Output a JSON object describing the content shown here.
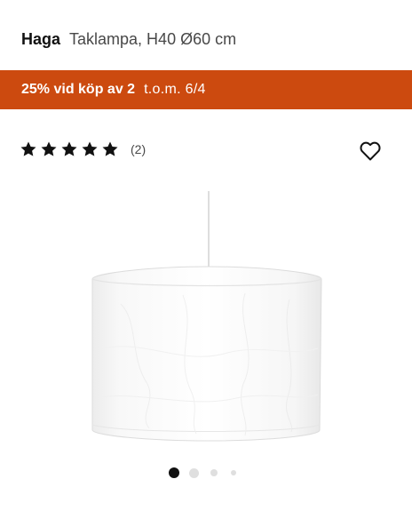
{
  "product": {
    "name": "Haga",
    "description": "Taklampa, H40 Ø60 cm"
  },
  "promo": {
    "text": "25% vid köp av 2",
    "date": "t.o.m. 6/4",
    "color": "#cc4a0f"
  },
  "rating": {
    "stars": 5,
    "max_stars": 5,
    "review_count": "(2)"
  },
  "favorite": {
    "icon": "heart-outline-icon"
  },
  "image": {
    "subject": "white pendant lamp shade"
  },
  "carousel": {
    "total_dots": 4,
    "active_index": 0
  }
}
